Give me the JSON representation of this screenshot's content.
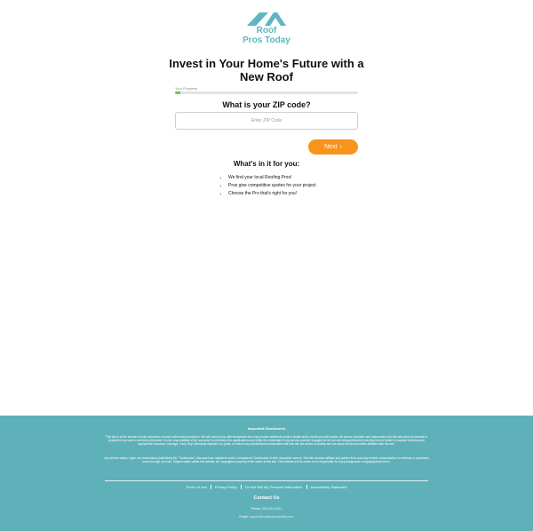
{
  "brand": {
    "line1": "Roof",
    "line2": "Pros Today",
    "color": "#5fb6c0"
  },
  "headline": "Invest in Your Home's Future with a New Roof",
  "progress": {
    "label": "Your Progress",
    "value_percent": 3,
    "color": "#7cc242"
  },
  "zip": {
    "question": "What is your ZIP code?",
    "placeholder": "Enter ZIP Code",
    "value": ""
  },
  "next_button": {
    "label": "Next",
    "color": "#f7941d"
  },
  "benefits": {
    "title": "What's in it for you:",
    "items": [
      "We find your local Roofing Pros!",
      "Pros give competitive quotes for your project",
      "Choose the Pro that's right for you!"
    ]
  },
  "footer": {
    "background": "#5fb1b9",
    "disclosures_title": "Important Disclosures",
    "disclosure_1": "This site is a free service to help consumers connect with service providers. We will connect you with businesses who may provide additional product details and/or assist you with quotes. All service providers are independent and this site does not warrant or guarantee any work or services performed. It is the responsibility of the consumer to determine the qualifications and verify the credentials of any service provider engaged for the service being performed including but not limited to required licensing and appropriate insurance coverage, if any. Any individuals depicted in a photo or video in any advertisement associated with this site are actors or models and not actual service providers affiliated with this site.",
    "disclosure_2": "Any service marks, logos, and trademarks (collectively the \"Trademarks\") discussed are registered and/or unregistered Trademarks of their respective owners. This site contains affiliate and partner links and may receive compensation for referrals or purchases made through our links. Subject matter within this website are copyrighted property of the owner of this site. This website and its owner is not responsible for any photographic or typographical errors.",
    "links": [
      "Terms of Use",
      "Privacy Policy",
      "Do Not Sell My Personal Information",
      "Accessibility Statement"
    ],
    "contact_title": "Contact Us",
    "phone_label": "Phone:",
    "phone_value": "855-553-6461",
    "email_label": "Email:",
    "email_value": "support@roofproprostoday.com"
  }
}
